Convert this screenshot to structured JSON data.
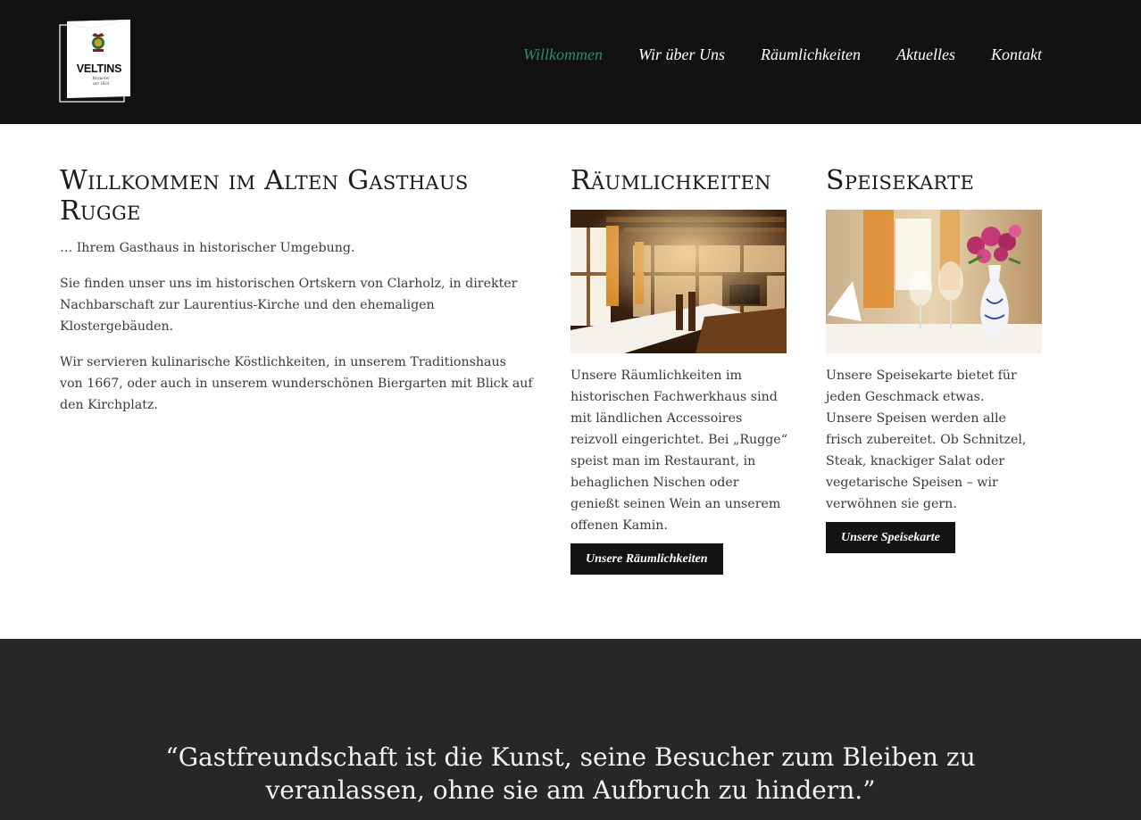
{
  "brand": {
    "logo_name": "VELTINS",
    "logo_sub": "Brauerei",
    "logo_year": "seit 1824"
  },
  "nav": {
    "items": [
      {
        "label": "Willkommen",
        "active": true
      },
      {
        "label": "Wir über Uns",
        "active": false
      },
      {
        "label": "Räumlichkeiten",
        "active": false
      },
      {
        "label": "Aktuelles",
        "active": false
      },
      {
        "label": "Kontakt",
        "active": false
      }
    ]
  },
  "welcome": {
    "title": "Willkommen im Alten Gasthaus Rugge",
    "intro": "… Ihrem Gasthaus in historischer Umgebung.",
    "para1": "Sie finden unser uns im historischen Ortskern von Clarholz, in direkter Nachbarschaft zur Laurentius-Kirche und den ehemaligen Klostergebäuden.",
    "para2": "Wir servieren kulinarische Köstlichkeiten, in unserem Traditionshaus von 1667, oder auch in unserem wunderschönen Biergarten mit Blick auf den Kirchplatz."
  },
  "rooms": {
    "title": "Räumlichkeiten",
    "image_icon": "restaurant-interior-photo",
    "text": "Unsere Räumlichkeiten im historischen Fachwerkhaus sind mit ländlichen Accessoires reizvoll eingerichtet. Bei „Rugge“ speist man im Restaurant, in behaglichen Nischen oder genießt seinen Wein an unserem offenen Kamin.",
    "button": "Unsere Räumlichkeiten"
  },
  "menu": {
    "title": "Speisekarte",
    "image_icon": "table-setting-flowers-photo",
    "text1": "Unsere Speisekarte bietet für jeden Geschmack etwas.",
    "text2": "Unsere Speisen werden alle frisch zubereitet. Ob Schnitzel, Steak, knackiger Salat oder vegetarische Speisen – wir verwöhnen sie gern.",
    "button": "Unsere Speisekarte"
  },
  "quote": {
    "text": "“Gastfreundschaft ist die Kunst, seine Besucher zum Bleiben zu veranlassen, ohne sie am Aufbruch zu hindern.”"
  },
  "colors": {
    "header_bg": "#121212",
    "nav_active": "#2e8b67",
    "button_bg": "#141414",
    "quote_bg": "#272727"
  }
}
